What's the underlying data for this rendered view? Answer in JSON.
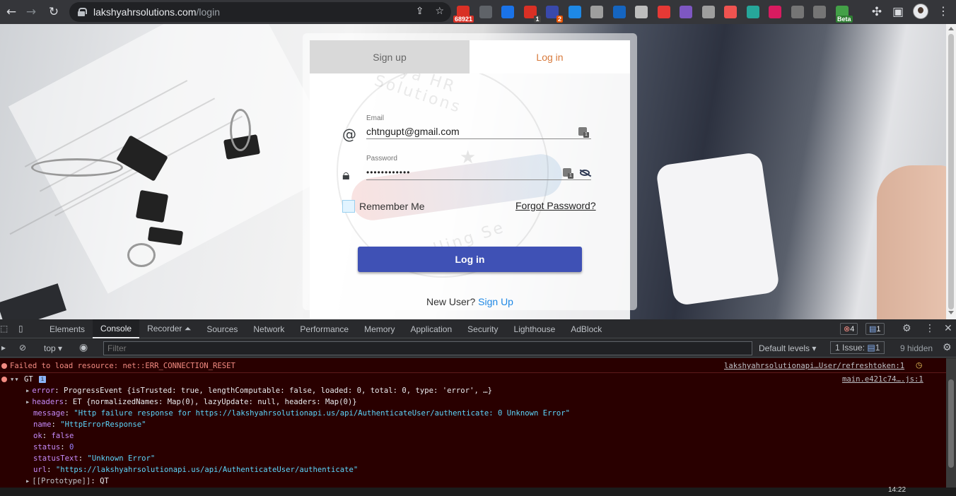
{
  "browser": {
    "url_host": "lakshyahrsolutions.com",
    "url_path": "/login",
    "extensions": [
      {
        "name": "gmail-extension",
        "color": "#d93025",
        "badge": "68921",
        "badge_color": "#d93025"
      },
      {
        "name": "pen-extension",
        "color": "#5f6368",
        "badge": "",
        "badge_color": "#c2185b"
      },
      {
        "name": "blue-circle-extension",
        "color": "#1a73e8",
        "badge": "",
        "badge_color": ""
      },
      {
        "name": "calendar-extension",
        "color": "#d93025",
        "badge": "1",
        "badge_color": "#444"
      },
      {
        "name": "sparkle-extension",
        "color": "#3949ab",
        "badge": "2",
        "badge_color": "#e65100"
      },
      {
        "name": "download-extension",
        "color": "#1e88e5",
        "badge": "",
        "badge_color": ""
      },
      {
        "name": "camera-extension",
        "color": "#9e9e9e",
        "badge": "",
        "badge_color": ""
      },
      {
        "name": "m-extension",
        "color": "#1565c0",
        "badge": "",
        "badge_color": ""
      },
      {
        "name": "bulb-extension",
        "color": "#bdbdbd",
        "badge": "",
        "badge_color": ""
      },
      {
        "name": "adblock-extension",
        "color": "#e53935",
        "badge": "",
        "badge_color": ""
      },
      {
        "name": "grid-extension",
        "color": "#7e57c2",
        "badge": "",
        "badge_color": ""
      },
      {
        "name": "shield-extension",
        "color": "#9e9e9e",
        "badge": "",
        "badge_color": ""
      },
      {
        "name": "arrow-extension",
        "color": "#ef5350",
        "badge": "",
        "badge_color": ""
      },
      {
        "name": "palm-extension",
        "color": "#26a69a",
        "badge": "",
        "badge_color": ""
      },
      {
        "name": "pink-extension",
        "color": "#d81b60",
        "badge": "",
        "badge_color": ""
      },
      {
        "name": "camera2-extension",
        "color": "#757575",
        "badge": "",
        "badge_color": ""
      },
      {
        "name": "recycle-extension",
        "color": "#757575",
        "badge": "",
        "badge_color": ""
      },
      {
        "name": "beta-extension",
        "color": "#43a047",
        "badge": "Beta",
        "badge_color": "#2e7d32"
      }
    ]
  },
  "login": {
    "tab_signup": "Sign up",
    "tab_login": "Log in",
    "email_label": "Email",
    "email_value": "chtngupt@gmail.com",
    "password_label": "Password",
    "password_value": "••••••••••••",
    "remember_label": "Remember Me",
    "forgot_label": "Forgot Password?",
    "login_button": "Log in",
    "new_user_text": "New User?",
    "signup_link": "Sign Up",
    "watermark_top": "shya HR Solutions",
    "watermark_bottom": "unselling Se",
    "accent": "#3f51b5",
    "tab_active_color": "#d87a3c"
  },
  "devtools": {
    "tabs": [
      "Elements",
      "Console",
      "Recorder ⏶",
      "Sources",
      "Network",
      "Performance",
      "Memory",
      "Application",
      "Security",
      "Lighthouse",
      "AdBlock"
    ],
    "active_tab": "Console",
    "error_count": "4",
    "message_count": "1",
    "context": "top",
    "filter_placeholder": "Filter",
    "levels": "Default levels",
    "issues_label": "1 Issue:",
    "issues_count": "1",
    "hidden": "9 hidden",
    "console": {
      "error1": "Failed to load resource: net::ERR_CONNECTION_RESET",
      "error1_source": "lakshyahrsolutionapi…User/refreshtoken:1",
      "group_label": "GT",
      "group_source": "main.e421c74….js:1",
      "lines": [
        {
          "key": "error",
          "value": "ProgressEvent {isTrusted: true, lengthComputable: false, loaded: 0, total: 0, type: 'error', …}",
          "expand": "true"
        },
        {
          "key": "headers",
          "value": "ET {normalizedNames: Map(0), lazyUpdate: null, headers: Map(0)}",
          "expand": "true"
        },
        {
          "key": "message",
          "value": "\"Http failure response for https://lakshyahrsolutionapi.us/api/AuthenticateUser/authenticate: 0 Unknown Error\"",
          "expand": "false"
        },
        {
          "key": "name",
          "value": "\"HttpErrorResponse\"",
          "expand": "false"
        },
        {
          "key": "ok",
          "value": "false",
          "expand": "false"
        },
        {
          "key": "status",
          "value": "0",
          "expand": "false"
        },
        {
          "key": "statusText",
          "value": "\"Unknown Error\"",
          "expand": "false"
        },
        {
          "key": "url",
          "value": "\"https://lakshyahrsolutionapi.us/api/AuthenticateUser/authenticate\"",
          "expand": "false"
        },
        {
          "key": "[[Prototype]]",
          "value": "QT",
          "expand": "true"
        }
      ]
    }
  },
  "taskbar": {
    "time": "14:22"
  }
}
